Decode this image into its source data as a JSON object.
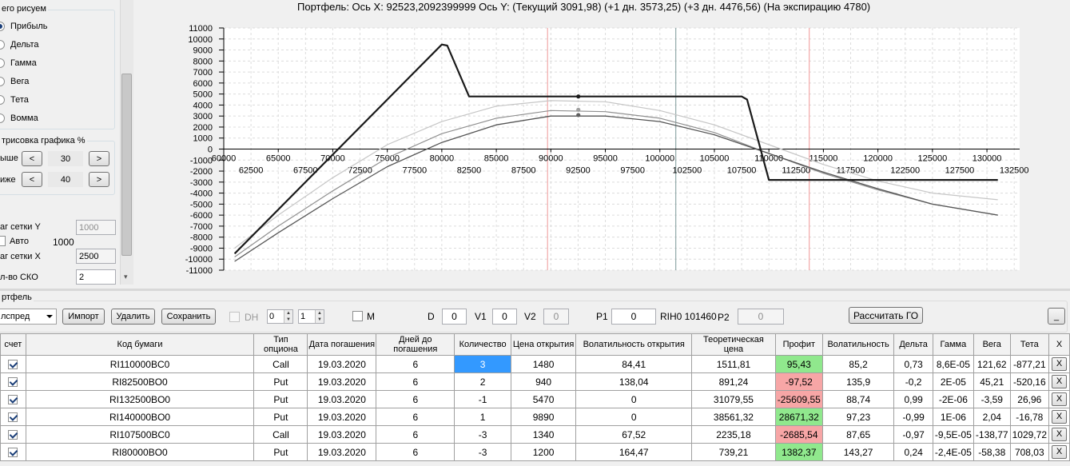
{
  "left_panel": {
    "draw_group_title": "его рисуем",
    "draw_options": [
      {
        "label": "Прибыль",
        "selected": true
      },
      {
        "label": "Дельта",
        "selected": false
      },
      {
        "label": "Гамма",
        "selected": false
      },
      {
        "label": "Вега",
        "selected": false
      },
      {
        "label": "Тета",
        "selected": false
      },
      {
        "label": "Вомма",
        "selected": false
      }
    ],
    "render_group_title": "трисовка графика %",
    "above_label": "ыше",
    "above_value": "30",
    "below_label": "иже",
    "below_value": "40",
    "dec_label": "<",
    "inc_label": ">",
    "grid_y_label": "аг сетки Y",
    "grid_y_value": "1000",
    "auto_label": "Авто",
    "auto_value": "1000",
    "grid_x_label": "аг сетки X",
    "grid_x_value": "2500",
    "sko_label": "л-во СКО",
    "sko_value": "2",
    "scroll_down_arrow": "▾"
  },
  "chart": {
    "title": "Портфель:  Ось X:  92523,2092399999  Ось Y:   (Текущий 3091,98)   (+1 дн. 3573,25)   (+3 дн. 4476,56)   (На экспирацию 4780)"
  },
  "chart_data": {
    "type": "line",
    "xlim": [
      60000,
      133000
    ],
    "ylim": [
      -11000,
      11000
    ],
    "y_ticks": [
      11000,
      10000,
      9000,
      8000,
      7000,
      6000,
      5000,
      4000,
      3000,
      2000,
      1000,
      0,
      -1000,
      -2000,
      -3000,
      -4000,
      -5000,
      -6000,
      -7000,
      -8000,
      -9000,
      -10000,
      -11000
    ],
    "x_ticks_upper": [
      60000,
      65000,
      70000,
      75000,
      80000,
      85000,
      90000,
      95000,
      100000,
      105000,
      110000,
      115000,
      120000,
      125000,
      130000
    ],
    "x_ticks_lower": [
      62500,
      67500,
      72500,
      77500,
      82500,
      87500,
      92500,
      97500,
      102500,
      107500,
      112500,
      117500,
      122500,
      127500,
      132500
    ],
    "vertical_markers": [
      {
        "x": 89700,
        "color": "#f2a8a8"
      },
      {
        "x": 101460,
        "color": "#90a8a8"
      },
      {
        "x": 113700,
        "color": "#f2a8a8"
      }
    ],
    "current_x": 92523,
    "series": [
      {
        "color": "#1a1a1a",
        "width": 2.2,
        "x": [
          61000,
          80000,
          80500,
          82500,
          107500,
          108000,
          110000,
          131000
        ],
        "y": [
          -9500,
          9500,
          9400,
          4780,
          4780,
          4500,
          -2800,
          -2800
        ]
      },
      {
        "color": "#c6c6c6",
        "width": 1.2,
        "x": [
          61000,
          65000,
          70000,
          75000,
          80000,
          85000,
          90000,
          95000,
          100000,
          105000,
          110000,
          115000,
          120000,
          125000,
          131000
        ],
        "y": [
          -9000,
          -6000,
          -2600,
          400,
          2500,
          3900,
          4400,
          4300,
          3500,
          2200,
          400,
          -1400,
          -2900,
          -4000,
          -4600
        ]
      },
      {
        "color": "#909090",
        "width": 1.2,
        "x": [
          61000,
          65000,
          70000,
          75000,
          80000,
          85000,
          90000,
          95000,
          100000,
          105000,
          110000,
          115000,
          120000,
          125000,
          131000
        ],
        "y": [
          -9800,
          -7000,
          -3800,
          -800,
          1400,
          2800,
          3500,
          3400,
          2800,
          1500,
          -400,
          -2200,
          -3700,
          -5000,
          -6000
        ]
      },
      {
        "color": "#555555",
        "width": 1.3,
        "x": [
          61000,
          65000,
          70000,
          75000,
          80000,
          85000,
          90000,
          95000,
          100000,
          105000,
          110000,
          115000,
          120000,
          125000,
          131000
        ],
        "y": [
          -10200,
          -7600,
          -4500,
          -1600,
          600,
          2200,
          3000,
          3000,
          2500,
          1300,
          -400,
          -2100,
          -3600,
          -5000,
          -6000
        ]
      }
    ],
    "points": [
      {
        "x": 92523,
        "y": 4780,
        "color": "#1a1a1a"
      },
      {
        "x": 92523,
        "y": 3573,
        "color": "#a0a0a0"
      },
      {
        "x": 92523,
        "y": 3092,
        "color": "#606060"
      }
    ]
  },
  "portfolio": {
    "section_title": "ртфель",
    "combo_value": "лспред",
    "import_label": "Импорт",
    "delete_label": "Удалить",
    "save_label": "Сохранить",
    "dh_label": "DH",
    "spin1": "0",
    "spin2": "1",
    "m_label": "M",
    "d_label": "D",
    "d_value": "0",
    "v1_label": "V1",
    "v1_value": "0",
    "v2_label": "V2",
    "v2_value": "0",
    "p1_label": "P1",
    "p1_value": "0",
    "ticker_info": "RIH0 101460",
    "p2_label": "P2",
    "p2_value": "0",
    "calc_label": "Рассчитать ГО",
    "minimize_label": "_"
  },
  "table": {
    "headers": [
      "счет",
      "Код бумаги",
      "Тип опциона",
      "Дата погашения",
      "Дней до погашения",
      "Количество",
      "Цена открытия",
      "Волатильность открытия",
      "Теоретическая цена",
      "Профит",
      "Волатильность",
      "Дельта",
      "Гамма",
      "Вега",
      "Тета",
      "X"
    ],
    "rows": [
      {
        "checked": true,
        "code": "RI110000BC0",
        "type": "Call",
        "date": "19.03.2020",
        "days": "6",
        "qty": "3",
        "open_price": "1480",
        "open_vol": "84,41",
        "theo": "1511,81",
        "profit": "95,43",
        "profit_sign": "pos",
        "vol": "85,2",
        "delta": "0,73",
        "gamma": "8,6E-05",
        "vega": "121,62",
        "theta": "-877,21",
        "x": "X"
      },
      {
        "checked": true,
        "code": "RI82500BO0",
        "type": "Put",
        "date": "19.03.2020",
        "days": "6",
        "qty": "2",
        "open_price": "940",
        "open_vol": "138,04",
        "theo": "891,24",
        "profit": "-97,52",
        "profit_sign": "neg",
        "vol": "135,9",
        "delta": "-0,2",
        "gamma": "2E-05",
        "vega": "45,21",
        "theta": "-520,16",
        "x": "X"
      },
      {
        "checked": true,
        "code": "RI132500BO0",
        "type": "Put",
        "date": "19.03.2020",
        "days": "6",
        "qty": "-1",
        "open_price": "5470",
        "open_vol": "0",
        "theo": "31079,55",
        "profit": "-25609,55",
        "profit_sign": "neg",
        "vol": "88,74",
        "delta": "0,99",
        "gamma": "-2E-06",
        "vega": "-3,59",
        "theta": "26,96",
        "x": "X"
      },
      {
        "checked": true,
        "code": "RI140000BO0",
        "type": "Put",
        "date": "19.03.2020",
        "days": "6",
        "qty": "1",
        "open_price": "9890",
        "open_vol": "0",
        "theo": "38561,32",
        "profit": "28671,32",
        "profit_sign": "pos",
        "vol": "97,23",
        "delta": "-0,99",
        "gamma": "1E-06",
        "vega": "2,04",
        "theta": "-16,78",
        "x": "X"
      },
      {
        "checked": true,
        "code": "RI107500BC0",
        "type": "Call",
        "date": "19.03.2020",
        "days": "6",
        "qty": "-3",
        "open_price": "1340",
        "open_vol": "67,52",
        "theo": "2235,18",
        "profit": "-2685,54",
        "profit_sign": "neg",
        "vol": "87,65",
        "delta": "-0,97",
        "gamma": "-9,5E-05",
        "vega": "-138,77",
        "theta": "1029,72",
        "x": "X"
      },
      {
        "checked": true,
        "code": "RI80000BO0",
        "type": "Put",
        "date": "19.03.2020",
        "days": "6",
        "qty": "-3",
        "open_price": "1200",
        "open_vol": "164,47",
        "theo": "739,21",
        "profit": "1382,37",
        "profit_sign": "pos",
        "vol": "143,27",
        "delta": "0,24",
        "gamma": "-2,4E-05",
        "vega": "-58,38",
        "theta": "708,03",
        "x": "X"
      }
    ]
  }
}
